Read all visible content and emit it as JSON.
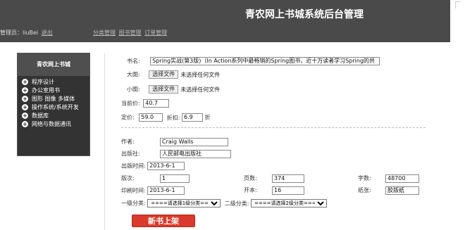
{
  "header": {
    "title": "青农网上书城系统后台管理",
    "admin_label": "管理员：liuBei",
    "logout": "退出",
    "nav": [
      "分类管理",
      "图书管理",
      "订单管理"
    ]
  },
  "sidebar": {
    "title": "青农网上书城",
    "items": [
      "程序设计",
      "办公室用书",
      "图形 图像 多媒体",
      "操作系统/系统开发",
      "数据库",
      "网络与数据通讯"
    ]
  },
  "form": {
    "book_name_label": "书名:",
    "book_name_value": "Spring实战(第3版)（In Action系列中最畅销的Spring图书，近十万读者学习Spring的共",
    "big_image_label": "大图:",
    "small_image_label": "小图:",
    "choose_file": "选择文件",
    "no_file": "未选择任何文件",
    "current_price_label": "当前价:",
    "current_price_value": "40.7",
    "list_price_label": "定价:",
    "list_price_value": "59.0",
    "discount_label": "折扣:",
    "discount_value": "6.9",
    "discount_unit": "折",
    "author_label": "作者:",
    "author_value": "Craig Walls",
    "publisher_label": "出版社:",
    "publisher_value": "人民邮电出版社",
    "publish_date_label": "出版时间:",
    "publish_date_value": "2013-6-1",
    "edition_label": "版次:",
    "edition_value": "1",
    "pages_label": "页数:",
    "pages_value": "374",
    "words_label": "字数:",
    "words_value": "48700",
    "print_date_label": "印刷时间:",
    "print_date_value": "2013-6-1",
    "format_label": "开本:",
    "format_value": "16",
    "paper_label": "纸张:",
    "paper_value": "胶版纸",
    "cat1_label": "一级分类:",
    "cat1_value": "====请选择1级分类====",
    "cat2_label": "二级分类:",
    "cat2_value": "====请选择2级分类===="
  },
  "submit_label": "新书上架"
}
